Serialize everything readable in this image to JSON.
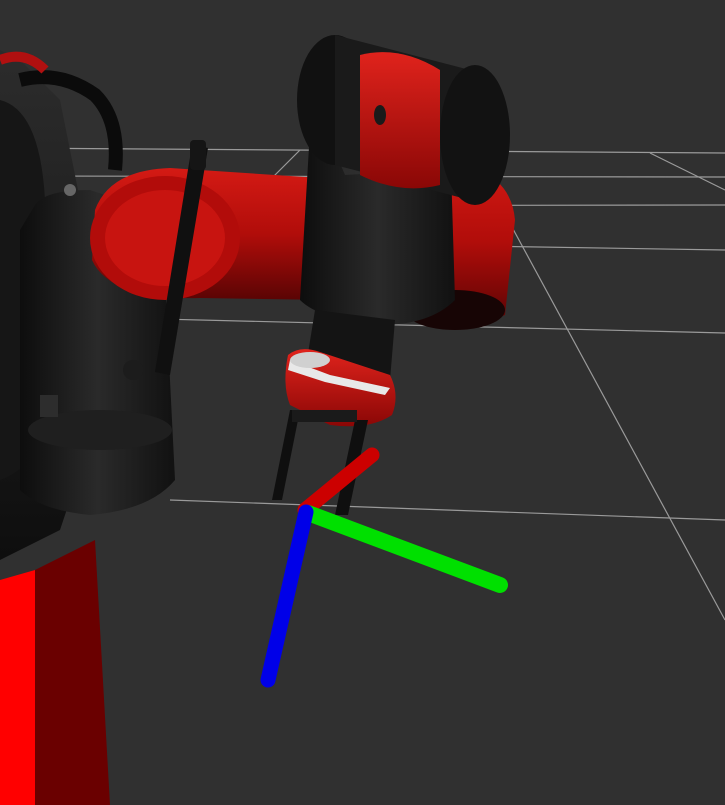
{
  "scene": {
    "background_color": "#303030",
    "grid_color": "#a0a0a0",
    "robot_primary_color": "#c0100c",
    "robot_secondary_color": "#1a1a1a",
    "robot_highlight_color": "#e8e8e8",
    "pedestal_color": "#ff0000",
    "axes": {
      "x_color": "#ff0000",
      "y_color": "#00ff00",
      "z_color": "#0000ff"
    }
  }
}
